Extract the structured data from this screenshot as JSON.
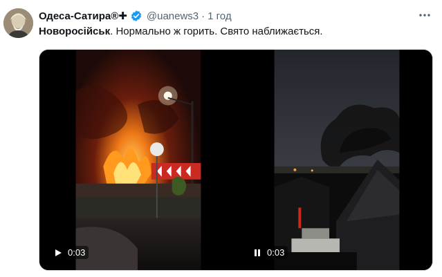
{
  "author": {
    "name": "Одеса-Сатира®✚",
    "handle": "@uanews3",
    "separator": "·",
    "time": "1 год",
    "verified": true
  },
  "more_icon": "more-horizontal-icon",
  "tweet": {
    "bold_text": "Новоросійськ",
    "text": ". Нормально ж горить. Свято наближається."
  },
  "media": {
    "videos": [
      {
        "state": "paused",
        "control_icon": "play-icon",
        "duration": "0:03"
      },
      {
        "state": "playing",
        "control_icon": "pause-icon",
        "duration": "0:03"
      }
    ]
  },
  "colors": {
    "text": "#0f1419",
    "secondary": "#536471",
    "verified": "#1d9bf0"
  }
}
